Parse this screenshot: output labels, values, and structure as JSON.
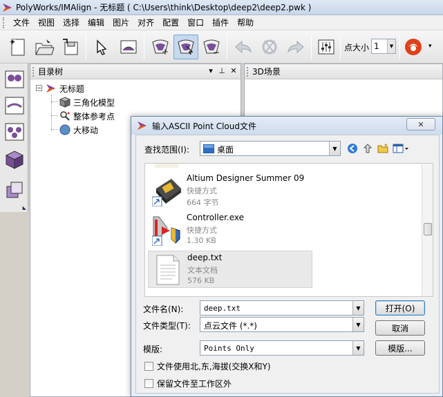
{
  "window": {
    "title": "PolyWorks/IMAlign - 无标题 ( C:\\Users\\think\\Desktop\\deep2\\deep2.pwk )"
  },
  "menu": [
    "文件",
    "视图",
    "选择",
    "编辑",
    "图片",
    "对齐",
    "配置",
    "窗口",
    "插件",
    "帮助"
  ],
  "toolbar": {
    "point_size_label": "点大小",
    "point_size_value": "1",
    "buttons": [
      "new-project-icon",
      "open-project-icon",
      "save-project-icon",
      "select-pointer-icon",
      "view-mode-icon",
      "add-to-tree-icon",
      "align-icon",
      "remove-align-icon",
      "undo-icon",
      "refresh-icon",
      "redo-icon",
      "settings-sliders-icon",
      "polyworks-logo-icon"
    ]
  },
  "tree_panel": {
    "title": "目录树",
    "root": "无标题",
    "children": [
      "三角化模型",
      "整体参考点",
      "大移动"
    ]
  },
  "scene_panel": {
    "title": "3D场景"
  },
  "dialog": {
    "title": "输入ASCII Point Cloud文件",
    "close_label": "✕",
    "look_in_label": "查找范围(I):",
    "look_in_value": "桌面",
    "files": [
      {
        "name": "Altium Designer Summer 09",
        "type": "快捷方式",
        "size": "664 字节"
      },
      {
        "name": "Controller.exe",
        "type": "快捷方式",
        "size": "1.30 KB"
      },
      {
        "name": "deep.txt",
        "type": "文本文档",
        "size": "576 KB"
      }
    ],
    "file_name_label": "文件名(N):",
    "file_name_value": "deep.txt",
    "file_type_label": "文件类型(T):",
    "file_type_value": "点云文件 (*.*)",
    "template_label": "模版:",
    "template_value": "Points Only",
    "open_button": "打开(O)",
    "cancel_button": "取消",
    "template_button": "模版...",
    "check_neh": "文件使用北,东,海拔(交换X和Y)",
    "check_keep": "保留文件至工作区外"
  }
}
